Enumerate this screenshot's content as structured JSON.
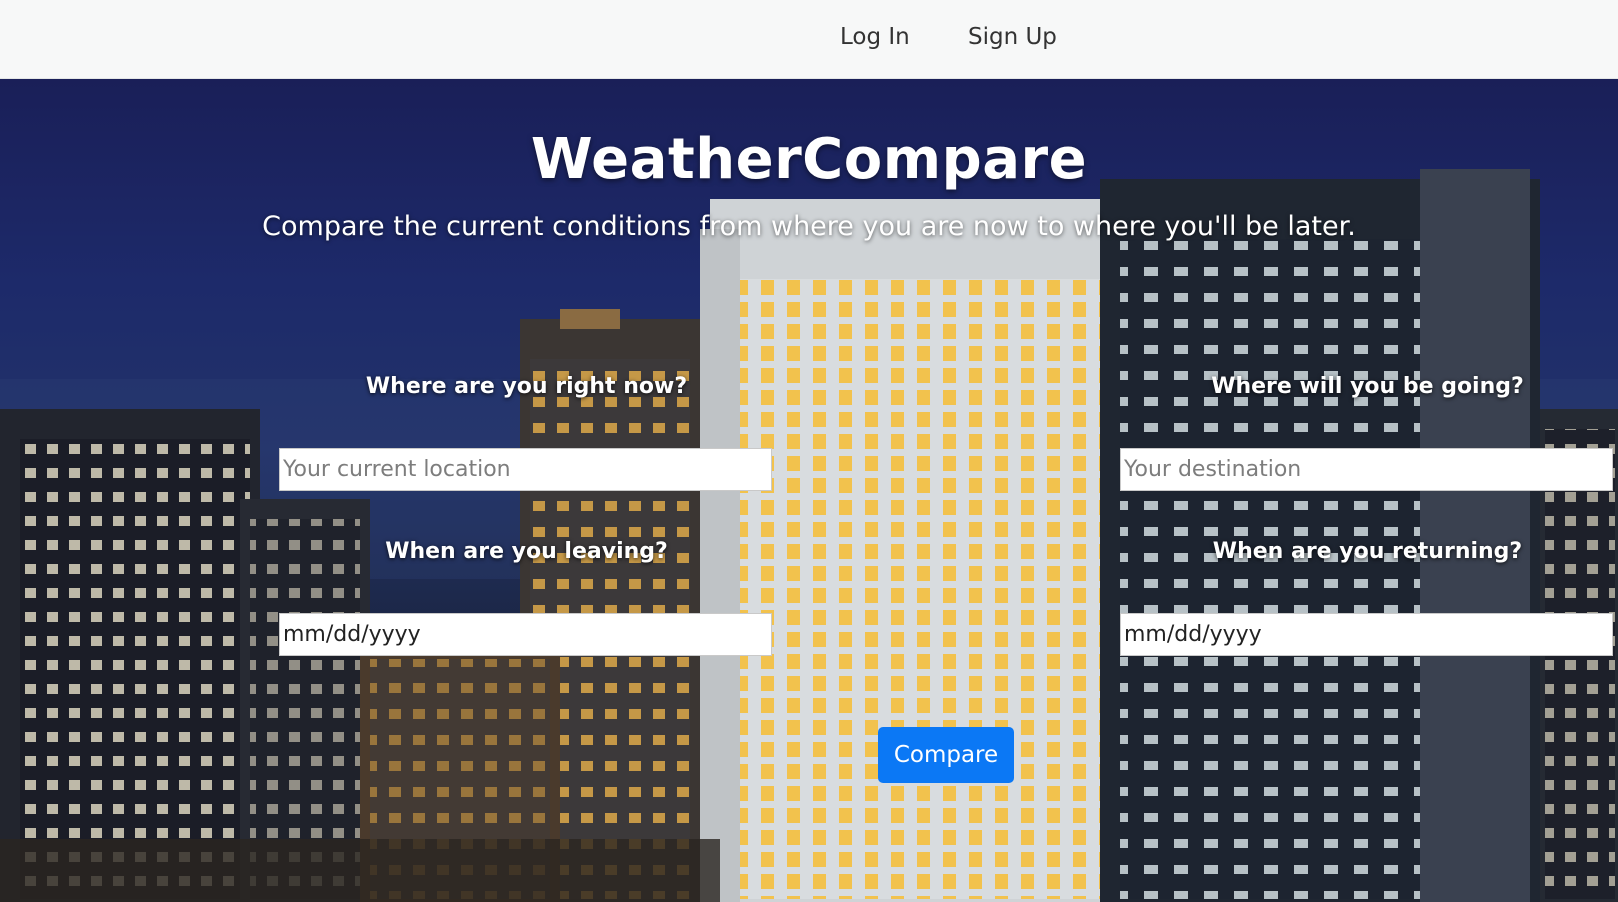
{
  "nav": {
    "login": "Log In",
    "signup": "Sign Up"
  },
  "hero": {
    "title": "WeatherCompare",
    "subtitle": "Compare the current conditions from where you are now to where you'll be later.",
    "background": "night-city-skyline-image"
  },
  "form": {
    "origin_label": "Where are you right now?",
    "origin_placeholder": "Your current location",
    "origin_value": "",
    "destination_label": "Where will you be going?",
    "destination_placeholder": "Your destination",
    "destination_value": "",
    "leaving_label": "When are you leaving?",
    "leaving_value": "mm/dd/yyyy",
    "returning_label": "When are you returning?",
    "returning_value": "mm/dd/yyyy",
    "submit_label": "Compare"
  },
  "colors": {
    "accent": "#0b78f5",
    "nav_bg": "#f7f8f8"
  }
}
